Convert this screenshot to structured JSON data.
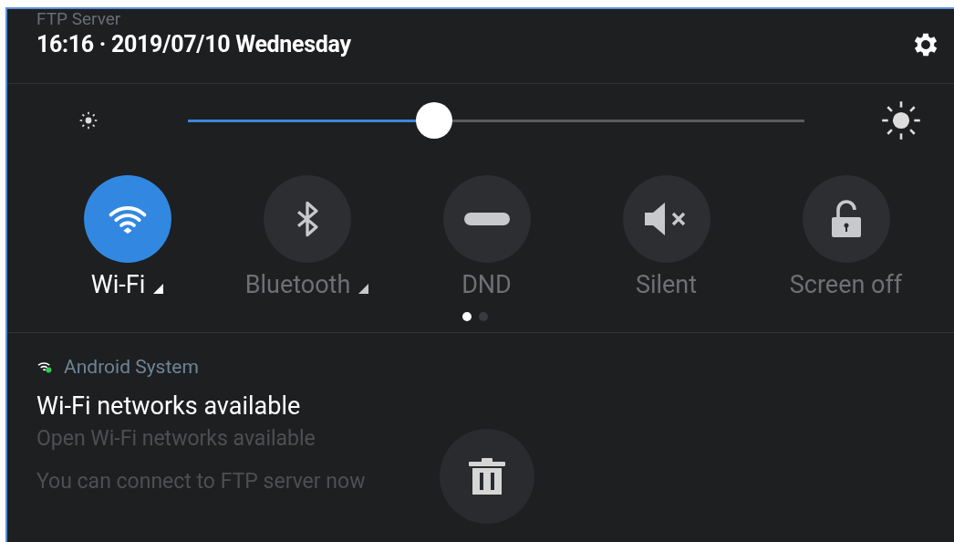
{
  "background_app": {
    "title": "FTP Server"
  },
  "header": {
    "datetime": "16:16 · 2019/07/10 Wednesday"
  },
  "brightness": {
    "level": 0.4
  },
  "tiles": [
    {
      "kind": "wifi",
      "label": "Wi-Fi",
      "on": true,
      "expandable": true
    },
    {
      "kind": "bluetooth",
      "label": "Bluetooth",
      "on": false,
      "expandable": true
    },
    {
      "kind": "dnd",
      "label": "DND",
      "on": false,
      "expandable": false
    },
    {
      "kind": "silent",
      "label": "Silent",
      "on": false,
      "expandable": false
    },
    {
      "kind": "lock",
      "label": "Screen off",
      "on": false,
      "expandable": false
    }
  ],
  "page_indicator": [
    {
      "selected": true
    },
    {
      "selected": false
    }
  ],
  "notification": {
    "app": "Android System",
    "title": "Wi-Fi networks available",
    "text": "Open Wi-Fi networks available",
    "extra": "You can connect to FTP server now"
  }
}
